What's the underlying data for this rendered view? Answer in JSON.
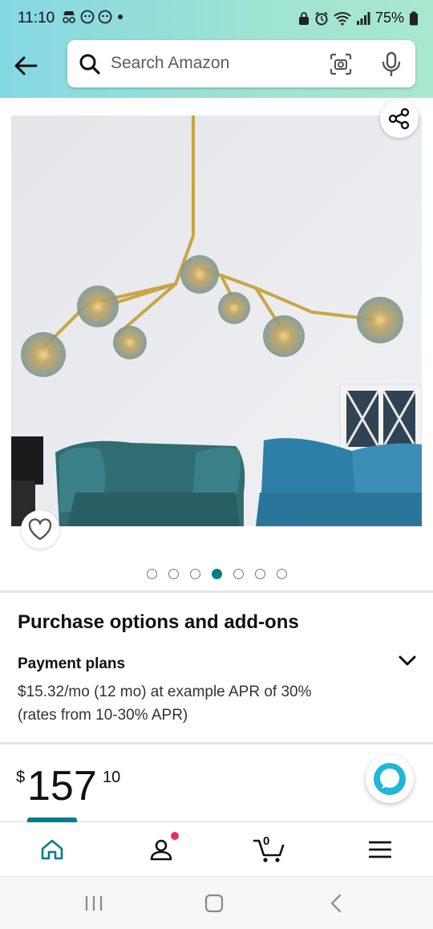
{
  "status_bar": {
    "time": "11:10",
    "battery": "75%"
  },
  "search": {
    "placeholder": "Search Amazon"
  },
  "carousel": {
    "total": 7,
    "active_index": 3
  },
  "purchase_options": {
    "title": "Purchase options and add-ons",
    "payment_plans_title": "Payment plans",
    "payment_plans_text": "$15.32/mo (12 mo) at example APR of 30% (rates from 10-30% APR)"
  },
  "price": {
    "symbol": "$",
    "whole": "157",
    "fraction": "10"
  },
  "bottom_nav": {
    "cart_count": "0",
    "items": [
      "home-icon",
      "account-icon",
      "cart-icon",
      "menu-icon"
    ]
  },
  "colors": {
    "accent": "#067d8a",
    "notification": "#e8305a",
    "header_gradient_start": "#84d8e3",
    "header_gradient_end": "#a8e8cf"
  }
}
